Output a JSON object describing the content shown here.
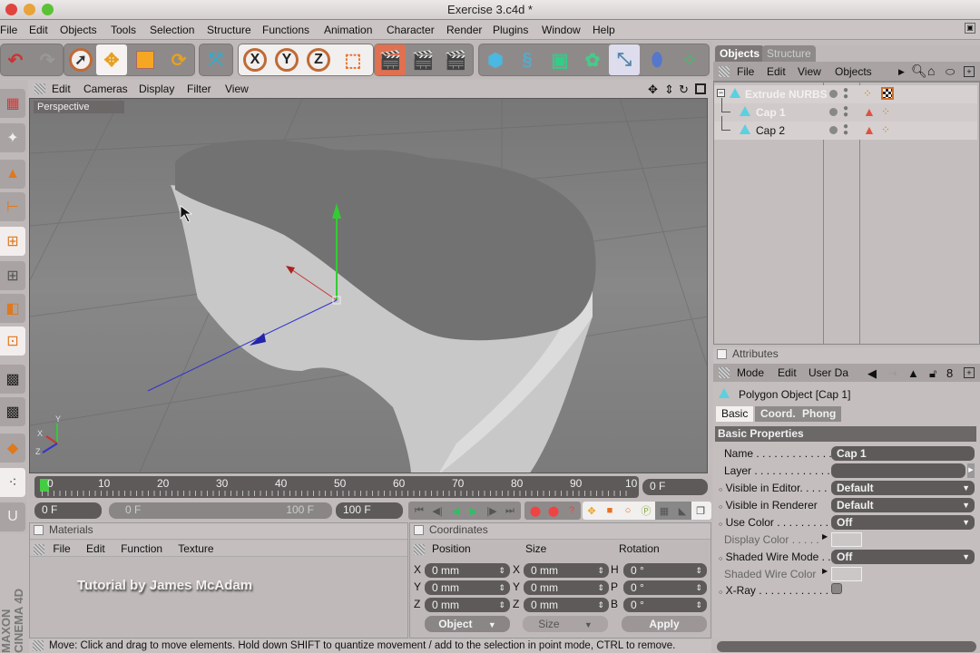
{
  "window": {
    "title": "Exercise 3.c4d *"
  },
  "menubar": {
    "items": [
      "File",
      "Edit",
      "Objects",
      "Tools",
      "Selection",
      "Structure",
      "Functions",
      "Animation",
      "Character",
      "Render",
      "Plugins",
      "Window",
      "Help"
    ]
  },
  "toolbar": {
    "tools": [
      {
        "name": "undo-icon"
      },
      {
        "name": "redo-icon"
      },
      {
        "name": "live-selection-icon"
      },
      {
        "name": "move-icon",
        "active": true
      },
      {
        "name": "scale-icon"
      },
      {
        "name": "rotate-icon"
      },
      {
        "name": "model-tool-icon"
      },
      {
        "name": "x-axis-lock",
        "label": "X"
      },
      {
        "name": "y-axis-lock",
        "label": "Y"
      },
      {
        "name": "z-axis-lock",
        "label": "Z"
      },
      {
        "name": "coordinate-system-icon"
      },
      {
        "name": "render-view-icon"
      },
      {
        "name": "render-picture-viewer-icon"
      },
      {
        "name": "render-settings-icon"
      },
      {
        "name": "cube-primitive-icon"
      },
      {
        "name": "spline-icon"
      },
      {
        "name": "nurbs-icon"
      },
      {
        "name": "array-icon"
      },
      {
        "name": "deformer-icon"
      },
      {
        "name": "environment-icon"
      },
      {
        "name": "particles-icon"
      }
    ]
  },
  "viewport": {
    "menu": [
      "Edit",
      "Cameras",
      "Display",
      "Filter",
      "View"
    ],
    "label": "Perspective",
    "axis_labels": {
      "x": "X",
      "y": "Y",
      "z": "Z"
    }
  },
  "timeline": {
    "ticks": [
      "0",
      "10",
      "20",
      "30",
      "40",
      "50",
      "60",
      "70",
      "80",
      "90",
      "10"
    ],
    "current_frame": "0 F",
    "start_frame": "0 F",
    "range_start": "0 F",
    "range_end": "100 F",
    "end_frame": "100 F"
  },
  "materials": {
    "title": "Materials",
    "menu": [
      "File",
      "Edit",
      "Function",
      "Texture"
    ],
    "overlay_text": "Tutorial by James McAdam"
  },
  "coordinates": {
    "title": "Coordinates",
    "headers": [
      "Position",
      "Size",
      "Rotation"
    ],
    "position": [
      {
        "axis": "X",
        "value": "0 mm"
      },
      {
        "axis": "Y",
        "value": "0 mm"
      },
      {
        "axis": "Z",
        "value": "0 mm"
      }
    ],
    "size": [
      {
        "axis": "X",
        "value": "0 mm"
      },
      {
        "axis": "Y",
        "value": "0 mm"
      },
      {
        "axis": "Z",
        "value": "0 mm"
      }
    ],
    "rotation": [
      {
        "axis": "H",
        "value": "0 °"
      },
      {
        "axis": "P",
        "value": "0 °"
      },
      {
        "axis": "B",
        "value": "0 °"
      }
    ],
    "mode_select": "Object",
    "size_select": "Size",
    "apply_label": "Apply"
  },
  "status": {
    "text": "Move: Click and drag to move elements. Hold down SHIFT to quantize movement / add to the selection in point mode, CTRL to remove."
  },
  "objects_manager": {
    "tabs": [
      "Objects",
      "Structure"
    ],
    "active_tab": "Objects",
    "menu": [
      "File",
      "Edit",
      "View",
      "Objects"
    ],
    "objects": [
      {
        "name": "Extrude NURBS",
        "level": 0,
        "selected": true,
        "expanded": true
      },
      {
        "name": "Cap 1",
        "level": 1,
        "selected": true
      },
      {
        "name": "Cap 2",
        "level": 1,
        "selected": false
      }
    ]
  },
  "attributes": {
    "title": "Attributes",
    "menu": [
      "Mode",
      "Edit",
      "User Dat"
    ],
    "object_title": "Polygon Object [Cap 1]",
    "tabs": [
      "Basic",
      "Coord.",
      "Phong"
    ],
    "active_tab": "Basic",
    "section": "Basic Properties",
    "props": [
      {
        "label": "Name . . . . . . . . . . . . . .",
        "value": "Cap 1",
        "type": "text"
      },
      {
        "label": "Layer . . . . . . . . . . . . . .",
        "value": "",
        "type": "layer"
      },
      {
        "label": "Visible in Editor. . . . .",
        "value": "Default",
        "type": "select",
        "anim": true
      },
      {
        "label": "Visible in Renderer",
        "value": "Default",
        "type": "select",
        "anim": true
      },
      {
        "label": "Use Color . . . . . . . . . .",
        "value": "Off",
        "type": "select",
        "anim": true
      },
      {
        "label": "Display Color . . . . .",
        "value": "",
        "type": "color",
        "dim": true
      },
      {
        "label": "Shaded Wire Mode . .",
        "value": "Off",
        "type": "select",
        "anim": true
      },
      {
        "label": "Shaded Wire Color",
        "value": "",
        "type": "color",
        "dim": true
      },
      {
        "label": "X-Ray . . . . . . . . . . . . .",
        "value": "",
        "type": "checkbox",
        "anim": true
      }
    ]
  }
}
